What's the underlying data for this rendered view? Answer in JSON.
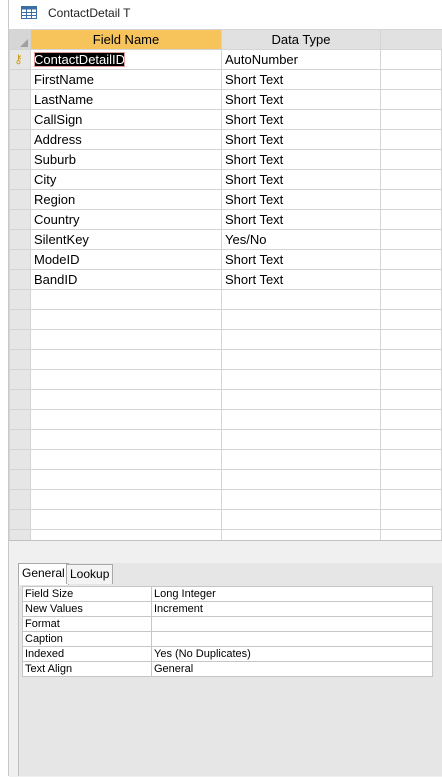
{
  "tab": {
    "title": "ContactDetail T"
  },
  "grid": {
    "headers": {
      "field_name": "Field Name",
      "data_type": "Data Type"
    },
    "rows": [
      {
        "field": "ContactDetailID",
        "type": "AutoNumber"
      },
      {
        "field": "FirstName",
        "type": "Short Text"
      },
      {
        "field": "LastName",
        "type": "Short Text"
      },
      {
        "field": "CallSign",
        "type": "Short Text"
      },
      {
        "field": "Address",
        "type": "Short Text"
      },
      {
        "field": "Suburb",
        "type": "Short Text"
      },
      {
        "field": "City",
        "type": "Short Text"
      },
      {
        "field": "Region",
        "type": "Short Text"
      },
      {
        "field": "Country",
        "type": "Short Text"
      },
      {
        "field": "SilentKey",
        "type": "Yes/No"
      },
      {
        "field": "ModeID",
        "type": "Short Text"
      },
      {
        "field": "BandID",
        "type": "Short Text"
      }
    ]
  },
  "properties": {
    "tabs": {
      "general": "General",
      "lookup": "Lookup"
    },
    "rows": [
      {
        "name": "Field Size",
        "value": "Long Integer"
      },
      {
        "name": "New Values",
        "value": "Increment"
      },
      {
        "name": "Format",
        "value": ""
      },
      {
        "name": "Caption",
        "value": ""
      },
      {
        "name": "Indexed",
        "value": "Yes (No Duplicates)"
      },
      {
        "name": "Text Align",
        "value": "General"
      }
    ]
  },
  "colors": {
    "header_active": "#f7c35b",
    "key_icon": "#d29b16"
  }
}
